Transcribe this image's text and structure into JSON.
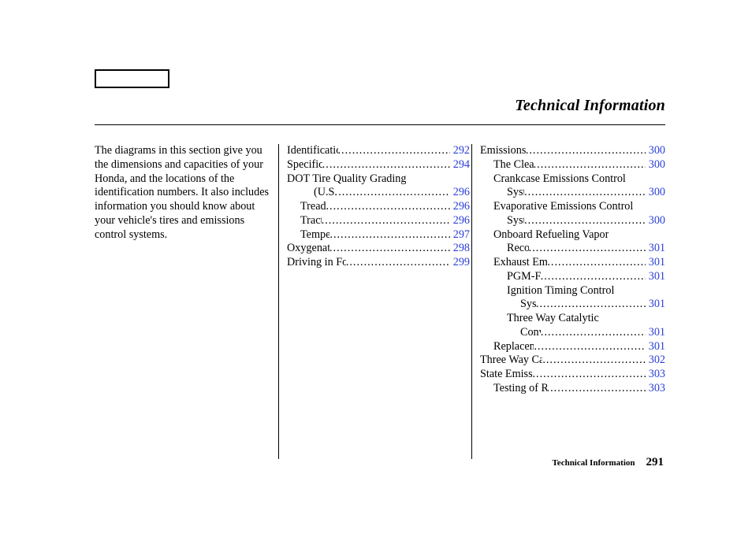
{
  "header": {
    "title": "Technical Information"
  },
  "intro": "The diagrams in this section give you the dimensions and capacities of your Honda, and the locations of the identification numbers. It also includes information you should know about your vehicle's tires and emissions control systems.",
  "col2": [
    {
      "label": "Identification Numbers",
      "page": "292",
      "indent": 0,
      "haspage": true
    },
    {
      "label": "Specifications",
      "page": "294",
      "indent": 0,
      "haspage": true
    },
    {
      "label": "DOT Tire Quality Grading",
      "page": "",
      "indent": 0,
      "haspage": false
    },
    {
      "label": "(U.S. Cars)",
      "page": "296",
      "indent": 2,
      "haspage": true
    },
    {
      "label": "Treadwear",
      "page": "296",
      "indent": 1,
      "haspage": true
    },
    {
      "label": "Traction",
      "page": "296",
      "indent": 1,
      "haspage": true
    },
    {
      "label": "Temperature",
      "page": "297",
      "indent": 1,
      "haspage": true
    },
    {
      "label": "Oxygenated Fuels",
      "page": "298",
      "indent": 0,
      "haspage": true
    },
    {
      "label": "Driving in Foreign Countries",
      "page": "299",
      "indent": 0,
      "haspage": true
    }
  ],
  "col3": [
    {
      "label": "Emissions Controls",
      "page": "300",
      "indent": 0,
      "haspage": true
    },
    {
      "label": "The Clean Air Act",
      "page": "300",
      "indent": 1,
      "haspage": true
    },
    {
      "label": "Crankcase Emissions Control",
      "page": "",
      "indent": 1,
      "haspage": false
    },
    {
      "label": "System",
      "page": "300",
      "indent": 2,
      "haspage": true
    },
    {
      "label": "Evaporative Emissions Control",
      "page": "",
      "indent": 1,
      "haspage": false
    },
    {
      "label": "System",
      "page": "300",
      "indent": 2,
      "haspage": true
    },
    {
      "label": "Onboard Refueling Vapor",
      "page": "",
      "indent": 1,
      "haspage": false
    },
    {
      "label": "Recovery",
      "page": "301",
      "indent": 2,
      "haspage": true
    },
    {
      "label": "Exhaust Emissions Controls",
      "page": "301",
      "indent": 1,
      "haspage": true
    },
    {
      "label": "PGM-FI System",
      "page": "301",
      "indent": 2,
      "haspage": true
    },
    {
      "label": "Ignition Timing Control",
      "page": "",
      "indent": 2,
      "haspage": false
    },
    {
      "label": "System",
      "page": "301",
      "indent": 3,
      "haspage": true
    },
    {
      "label": "Three Way Catalytic",
      "page": "",
      "indent": 2,
      "haspage": false
    },
    {
      "label": "Converter",
      "page": "301",
      "indent": 3,
      "haspage": true
    },
    {
      "label": "Replacement Parts",
      "page": "301",
      "indent": 1,
      "haspage": true
    },
    {
      "label": "Three Way Catalytic Converter",
      "page": "302",
      "indent": 0,
      "haspage": true
    },
    {
      "label": "State Emissions Testing",
      "page": "303",
      "indent": 0,
      "haspage": true
    },
    {
      "label": "Testing of Readiness Codes",
      "page": "303",
      "indent": 1,
      "haspage": true
    }
  ],
  "footer": {
    "label": "Technical Information",
    "page": "291"
  }
}
